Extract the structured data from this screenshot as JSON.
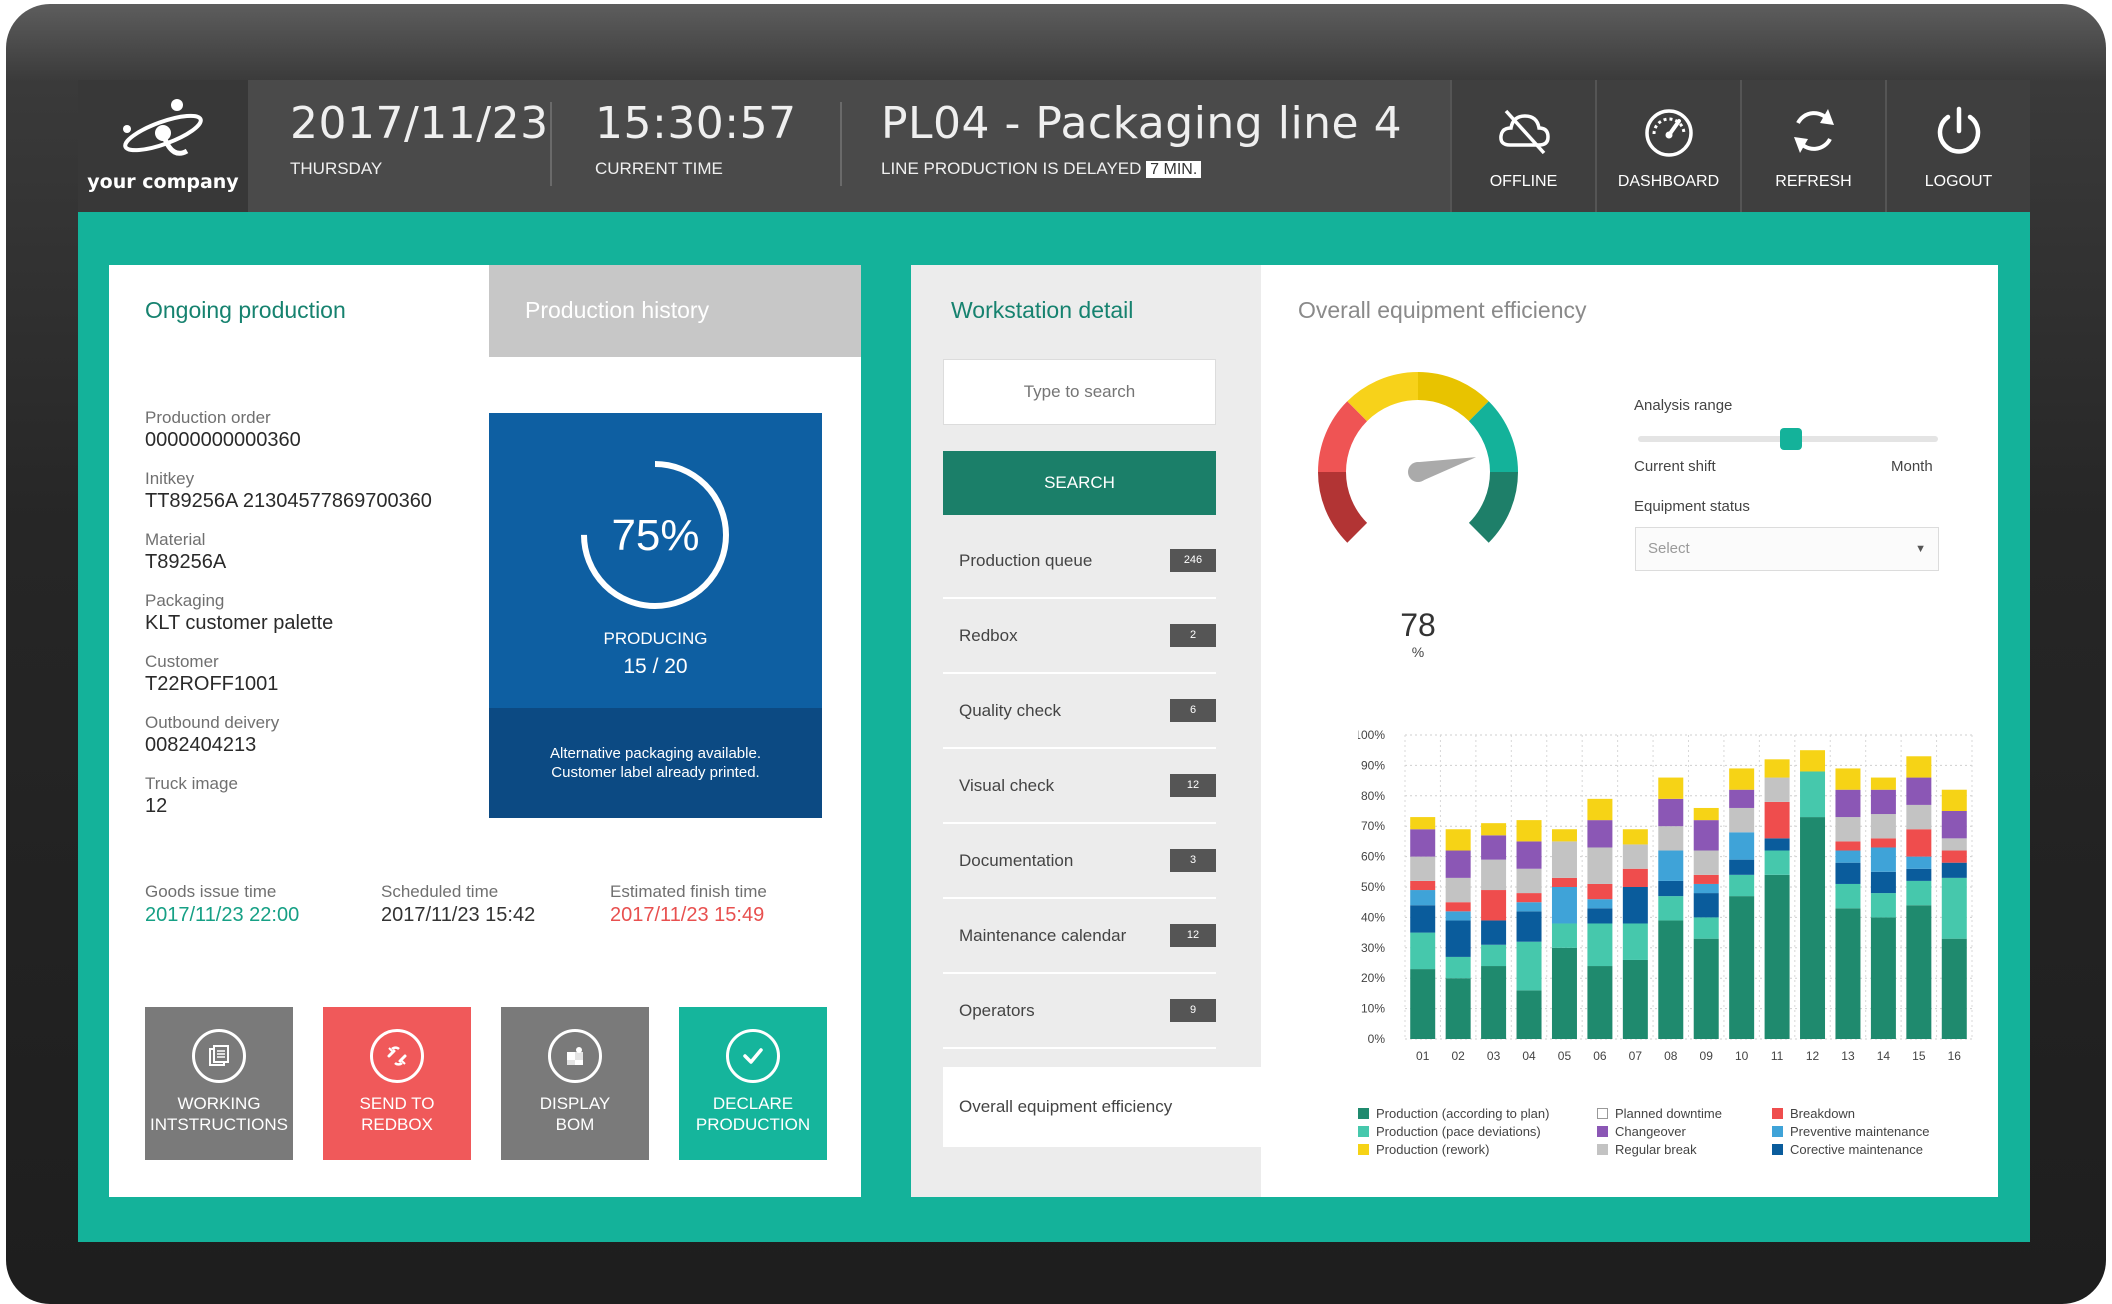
{
  "header": {
    "company": "your company",
    "date": "2017/11/23",
    "weekday": "THURSDAY",
    "time": "15:30:57",
    "time_label": "CURRENT TIME",
    "line_title": "PL04 - Packaging line 4",
    "delay_text": "LINE PRODUCTION IS DELAYED",
    "delay_badge": "7 MIN.",
    "buttons": [
      {
        "label": "OFFLINE",
        "icon": "cloud-offline-icon"
      },
      {
        "label": "DASHBOARD",
        "icon": "speedometer-icon"
      },
      {
        "label": "REFRESH",
        "icon": "refresh-icon"
      },
      {
        "label": "LOGOUT",
        "icon": "power-icon"
      }
    ]
  },
  "left": {
    "tab_active": "Ongoing production",
    "tab_inactive": "Production history",
    "fields": [
      {
        "label": "Production order",
        "value": "00000000000360"
      },
      {
        "label": "Initkey",
        "value": "TT89256A 21304577869700360"
      },
      {
        "label": "Material",
        "value": "T89256A"
      },
      {
        "label": "Packaging",
        "value": "KLT customer palette"
      },
      {
        "label": "Customer",
        "value": "T22ROFF1001"
      },
      {
        "label": "Outbound deivery",
        "value": "0082404213"
      },
      {
        "label": "Truck image",
        "value": "12"
      }
    ],
    "progress": {
      "percent_text": "75%",
      "fraction": 0.75,
      "status": "PRODUCING",
      "count": "15 / 20"
    },
    "note_line1": "Alternative packaging available.",
    "note_line2": "Customer label already printed.",
    "times": [
      {
        "label": "Goods issue time",
        "value": "2017/11/23 22:00",
        "color": "#16a085"
      },
      {
        "label": "Scheduled time",
        "value": "2017/11/23 15:42",
        "color": "#333333"
      },
      {
        "label": "Estimated finish time",
        "value": "2017/11/23 15:49",
        "color": "#e8504f"
      }
    ],
    "actions": [
      {
        "line1": "WORKING",
        "line2": "INTSTRUCTIONS",
        "color": "#7a7a7a",
        "icon": "document-icon"
      },
      {
        "line1": "SEND TO",
        "line2": "REDBOX",
        "color": "#f0595a",
        "icon": "broken-link-icon"
      },
      {
        "line1": "DISPLAY",
        "line2": "BOM",
        "color": "#7a7a7a",
        "icon": "puzzle-icon"
      },
      {
        "line1": "DECLARE",
        "line2": "PRODUCTION",
        "color": "#15b59c",
        "icon": "checkmark-icon"
      }
    ]
  },
  "workstation": {
    "title": "Workstation detail",
    "search_placeholder": "Type to search",
    "search_button": "SEARCH",
    "items": [
      {
        "label": "Production queue",
        "count": "246"
      },
      {
        "label": "Redbox",
        "count": "2"
      },
      {
        "label": "Quality check",
        "count": "6"
      },
      {
        "label": "Visual check",
        "count": "12"
      },
      {
        "label": "Documentation",
        "count": "3"
      },
      {
        "label": "Maintenance calendar",
        "count": "12"
      },
      {
        "label": "Operators",
        "count": "9"
      }
    ],
    "active_item": "Overall equipment efficiency"
  },
  "oee": {
    "title": "Overall equipment efficiency",
    "gauge_value": "78",
    "gauge_unit": "%",
    "analysis_range_label": "Analysis range",
    "range_left": "Current shift",
    "range_right": "Month",
    "slider_fraction": 0.5,
    "equipment_status_label": "Equipment status",
    "equipment_status_value": "Select"
  },
  "chart_data": {
    "type": "bar",
    "stacked": true,
    "categories": [
      "01",
      "02",
      "03",
      "04",
      "05",
      "06",
      "07",
      "08",
      "09",
      "10",
      "11",
      "12",
      "13",
      "14",
      "15",
      "16"
    ],
    "ylim": [
      0,
      100
    ],
    "y_ticks": [
      "0%",
      "10%",
      "20%",
      "30%",
      "40%",
      "50%",
      "60%",
      "70%",
      "80%",
      "90%",
      "100%"
    ],
    "series": [
      {
        "name": "Production (according to plan)",
        "color": "#1f8a6e",
        "values": [
          23,
          20,
          24,
          16,
          30,
          24,
          26,
          39,
          33,
          47,
          54,
          73,
          43,
          40,
          44,
          33
        ]
      },
      {
        "name": "Production (pace deviations)",
        "color": "#46c8ac",
        "values": [
          12,
          7,
          7,
          16,
          8,
          14,
          12,
          8,
          7,
          7,
          8,
          15,
          8,
          8,
          8,
          20
        ]
      },
      {
        "name": "Corective maintenance",
        "color": "#0a5c9c",
        "values": [
          9,
          12,
          8,
          10,
          0,
          5,
          12,
          5,
          8,
          5,
          4,
          0,
          7,
          7,
          4,
          5
        ]
      },
      {
        "name": "Preventive maintenance",
        "color": "#3fa3d8",
        "values": [
          5,
          3,
          0,
          3,
          12,
          3,
          0,
          10,
          3,
          9,
          0,
          0,
          4,
          8,
          4,
          0
        ]
      },
      {
        "name": "Breakdown",
        "color": "#ef4d4d",
        "values": [
          3,
          3,
          10,
          3,
          3,
          5,
          6,
          0,
          3,
          0,
          12,
          0,
          3,
          3,
          9,
          4
        ]
      },
      {
        "name": "Regular break",
        "color": "#c3c3c3",
        "values": [
          8,
          8,
          10,
          8,
          12,
          12,
          8,
          8,
          8,
          8,
          8,
          0,
          8,
          8,
          8,
          4
        ]
      },
      {
        "name": "Changeover",
        "color": "#8b57b5",
        "values": [
          9,
          9,
          8,
          9,
          0,
          9,
          0,
          9,
          10,
          6,
          0,
          0,
          9,
          8,
          9,
          9
        ]
      },
      {
        "name": "Production (rework)",
        "color": "#f6d316",
        "values": [
          4,
          7,
          4,
          7,
          4,
          7,
          5,
          7,
          4,
          7,
          6,
          7,
          7,
          4,
          7,
          7
        ]
      },
      {
        "name": "Planned downtime",
        "color": "#ffffff",
        "values": [
          0,
          0,
          0,
          0,
          0,
          0,
          0,
          0,
          0,
          0,
          0,
          0,
          0,
          0,
          0,
          0
        ]
      }
    ],
    "legend": [
      {
        "name": "Production (according to plan)",
        "color": "#1f8a6e"
      },
      {
        "name": "Planned downtime",
        "color": "#ffffff"
      },
      {
        "name": "Breakdown",
        "color": "#ef4d4d"
      },
      {
        "name": "Production (pace deviations)",
        "color": "#46c8ac"
      },
      {
        "name": "Changeover",
        "color": "#8b57b5"
      },
      {
        "name": "Preventive maintenance",
        "color": "#3fa3d8"
      },
      {
        "name": "Production (rework)",
        "color": "#f6d316"
      },
      {
        "name": "Regular break",
        "color": "#c3c3c3"
      },
      {
        "name": "Corective maintenance",
        "color": "#0a5c9c"
      }
    ],
    "grid": true,
    "legend_position": "bottom"
  }
}
